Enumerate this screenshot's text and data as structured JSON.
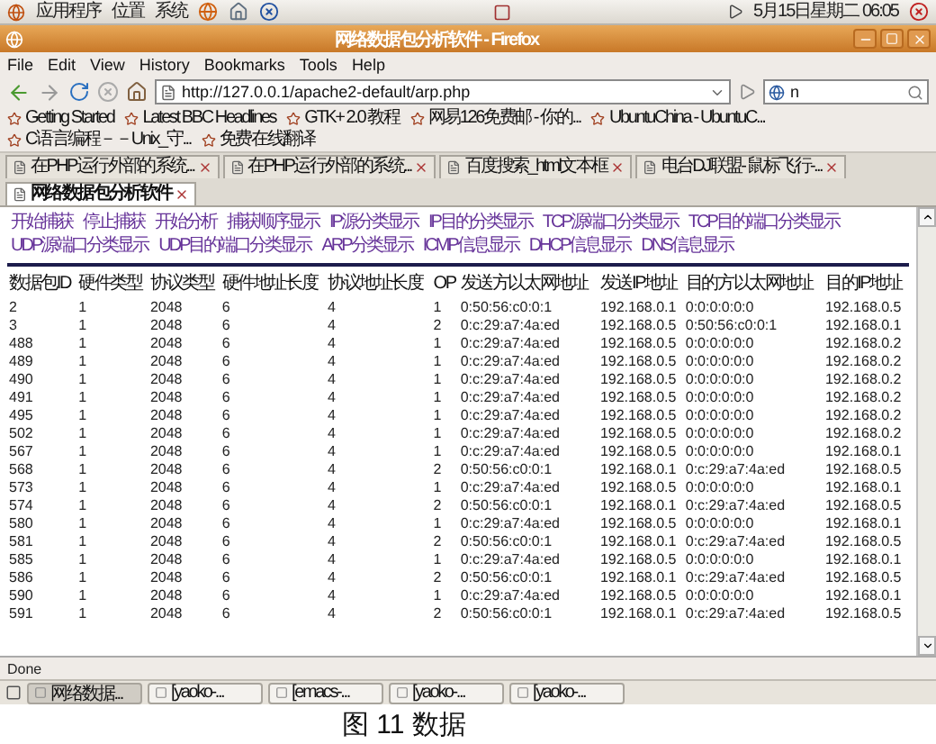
{
  "top_panel": {
    "menus": [
      "应用程序",
      "位置",
      "系统"
    ],
    "clock": "5月15日星期二 06:05"
  },
  "window": {
    "title": "网络数据包分析软件 - Firefox"
  },
  "menu_bar": [
    "File",
    "Edit",
    "View",
    "History",
    "Bookmarks",
    "Tools",
    "Help"
  ],
  "address_bar": {
    "value": "http://127.0.0.1/apache2-default/arp.php"
  },
  "search": {
    "value": "n"
  },
  "bookmarks": [
    "Getting Started",
    "Latest BBC Headlines",
    "GTK+ 2.0 教程",
    "网易126免费邮 - 你的...",
    "UbuntuChina - UbuntuC...",
    "C语言编程－－Unix_守...",
    "免费在线翻译"
  ],
  "tabs": [
    {
      "label": "在PHP运行外部的系统...",
      "selected": false
    },
    {
      "label": "在PHP运行外部的系统...",
      "selected": false
    },
    {
      "label": "百度搜索_html文本框",
      "selected": false
    },
    {
      "label": "电台DJ联盟- 鼠标飞行-...",
      "selected": false
    },
    {
      "label": "网络数据包分析软件",
      "selected": true
    }
  ],
  "page": {
    "links": [
      "开始捕获",
      "停止捕获",
      "开始分析",
      "捕获顺序显示",
      "IP源分类显示",
      "IP目的分类显示",
      "TCP源端口分类显示",
      "TCP目的端口分类显示",
      "UDP源端口分类显示",
      "UDP目的端口分类显示",
      "ARP分类显示",
      "ICMP信息显示",
      "DHCP信息显示",
      "DNS信息显示"
    ],
    "table": {
      "columns": [
        "数据包ID",
        "硬件类型",
        "协议类型",
        "硬件地址长度",
        "协议地址长度",
        "OP",
        "发送方以太网地址",
        "发送IP地址",
        "目的方以太网地址",
        "目的IP地址"
      ],
      "rows": [
        [
          "2",
          "1",
          "2048",
          "6",
          "4",
          "1",
          "0:50:56:c0:0:1",
          "192.168.0.1",
          "0:0:0:0:0:0",
          "192.168.0.5"
        ],
        [
          "3",
          "1",
          "2048",
          "6",
          "4",
          "2",
          "0:c:29:a7:4a:ed",
          "192.168.0.5",
          "0:50:56:c0:0:1",
          "192.168.0.1"
        ],
        [
          "488",
          "1",
          "2048",
          "6",
          "4",
          "1",
          "0:c:29:a7:4a:ed",
          "192.168.0.5",
          "0:0:0:0:0:0",
          "192.168.0.2"
        ],
        [
          "489",
          "1",
          "2048",
          "6",
          "4",
          "1",
          "0:c:29:a7:4a:ed",
          "192.168.0.5",
          "0:0:0:0:0:0",
          "192.168.0.2"
        ],
        [
          "490",
          "1",
          "2048",
          "6",
          "4",
          "1",
          "0:c:29:a7:4a:ed",
          "192.168.0.5",
          "0:0:0:0:0:0",
          "192.168.0.2"
        ],
        [
          "491",
          "1",
          "2048",
          "6",
          "4",
          "1",
          "0:c:29:a7:4a:ed",
          "192.168.0.5",
          "0:0:0:0:0:0",
          "192.168.0.2"
        ],
        [
          "495",
          "1",
          "2048",
          "6",
          "4",
          "1",
          "0:c:29:a7:4a:ed",
          "192.168.0.5",
          "0:0:0:0:0:0",
          "192.168.0.2"
        ],
        [
          "502",
          "1",
          "2048",
          "6",
          "4",
          "1",
          "0:c:29:a7:4a:ed",
          "192.168.0.5",
          "0:0:0:0:0:0",
          "192.168.0.2"
        ],
        [
          "567",
          "1",
          "2048",
          "6",
          "4",
          "1",
          "0:c:29:a7:4a:ed",
          "192.168.0.5",
          "0:0:0:0:0:0",
          "192.168.0.1"
        ],
        [
          "568",
          "1",
          "2048",
          "6",
          "4",
          "2",
          "0:50:56:c0:0:1",
          "192.168.0.1",
          "0:c:29:a7:4a:ed",
          "192.168.0.5"
        ],
        [
          "573",
          "1",
          "2048",
          "6",
          "4",
          "1",
          "0:c:29:a7:4a:ed",
          "192.168.0.5",
          "0:0:0:0:0:0",
          "192.168.0.1"
        ],
        [
          "574",
          "1",
          "2048",
          "6",
          "4",
          "2",
          "0:50:56:c0:0:1",
          "192.168.0.1",
          "0:c:29:a7:4a:ed",
          "192.168.0.5"
        ],
        [
          "580",
          "1",
          "2048",
          "6",
          "4",
          "1",
          "0:c:29:a7:4a:ed",
          "192.168.0.5",
          "0:0:0:0:0:0",
          "192.168.0.1"
        ],
        [
          "581",
          "1",
          "2048",
          "6",
          "4",
          "2",
          "0:50:56:c0:0:1",
          "192.168.0.1",
          "0:c:29:a7:4a:ed",
          "192.168.0.5"
        ],
        [
          "585",
          "1",
          "2048",
          "6",
          "4",
          "1",
          "0:c:29:a7:4a:ed",
          "192.168.0.5",
          "0:0:0:0:0:0",
          "192.168.0.1"
        ],
        [
          "586",
          "1",
          "2048",
          "6",
          "4",
          "2",
          "0:50:56:c0:0:1",
          "192.168.0.1",
          "0:c:29:a7:4a:ed",
          "192.168.0.5"
        ],
        [
          "590",
          "1",
          "2048",
          "6",
          "4",
          "1",
          "0:c:29:a7:4a:ed",
          "192.168.0.5",
          "0:0:0:0:0:0",
          "192.168.0.1"
        ],
        [
          "591",
          "1",
          "2048",
          "6",
          "4",
          "2",
          "0:50:56:c0:0:1",
          "192.168.0.1",
          "0:c:29:a7:4a:ed",
          "192.168.0.5"
        ]
      ]
    }
  },
  "status_bar": "Done",
  "taskbar": [
    {
      "label": "网络数据...",
      "selected": true
    },
    {
      "label": "[yaoko-...",
      "selected": false
    },
    {
      "label": "[emacs-...",
      "selected": false
    },
    {
      "label": "[yaoko-...",
      "selected": false
    },
    {
      "label": "[yaoko-...",
      "selected": false
    }
  ],
  "caption": "图 11 数据"
}
